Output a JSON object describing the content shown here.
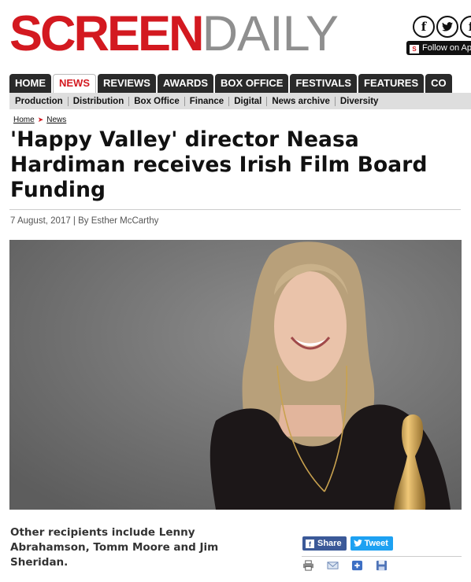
{
  "brand": {
    "part1": "SCREEN",
    "part2": "DAILY"
  },
  "social": {
    "facebook_glyph": "f",
    "twitter_glyph": "❧",
    "pinterest_glyph": "f",
    "follow_label": "Follow on Ap"
  },
  "main_nav": [
    "HOME",
    "NEWS",
    "REVIEWS",
    "AWARDS",
    "BOX OFFICE",
    "FESTIVALS",
    "FEATURES",
    "CO"
  ],
  "main_nav_active": "NEWS",
  "sub_nav": [
    "Production",
    "Distribution",
    "Box Office",
    "Finance",
    "Digital",
    "News archive",
    "Diversity"
  ],
  "breadcrumb": {
    "home": "Home",
    "separator": "➤",
    "section": "News"
  },
  "article": {
    "headline": "'Happy Valley' director Neasa Hardiman receives Irish Film Board Funding",
    "byline": "7 August, 2017 | By Esther McCarthy",
    "standfirst": "Other recipients include Lenny Abrahamson, Tomm Moore and Jim Sheridan."
  },
  "share": {
    "facebook_label": "Share",
    "twitter_label": "Tweet",
    "facebook_glyph": "f",
    "twitter_glyph": "❧"
  },
  "tools": [
    "print-icon",
    "email-icon",
    "add-icon",
    "save-icon"
  ],
  "colors": {
    "brand_red": "#d31920",
    "brand_grey": "#8f8f8f",
    "nav_dark": "#2a2a2a",
    "subnav_bg": "#dedede",
    "facebook": "#3b5998",
    "twitter": "#1da1f2"
  }
}
